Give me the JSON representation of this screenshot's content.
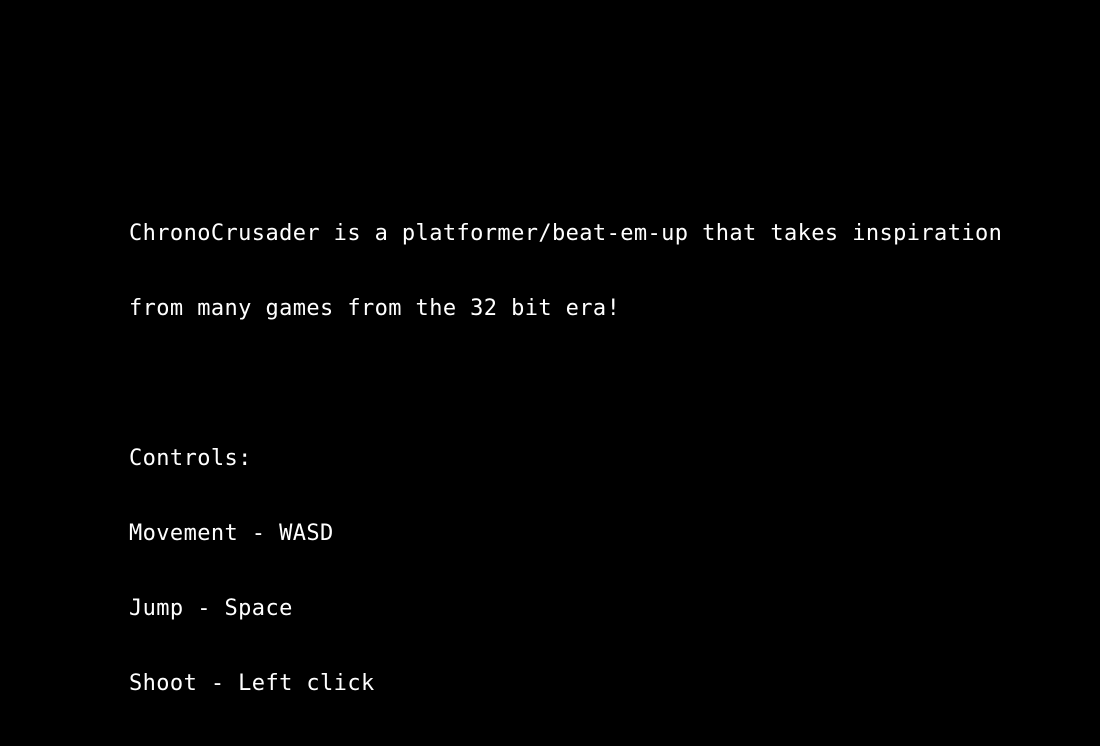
{
  "description_lines": [
    "ChronoCrusader is a platformer/beat-em-up that takes inspiration",
    "from many games from the 32 bit era!"
  ],
  "controls": {
    "heading": "Controls:",
    "items": [
      "Movement - WASD",
      "Jump - Space",
      "Shoot - Left click"
    ]
  },
  "colors": {
    "background": "#000000",
    "text": "#ffffff"
  }
}
